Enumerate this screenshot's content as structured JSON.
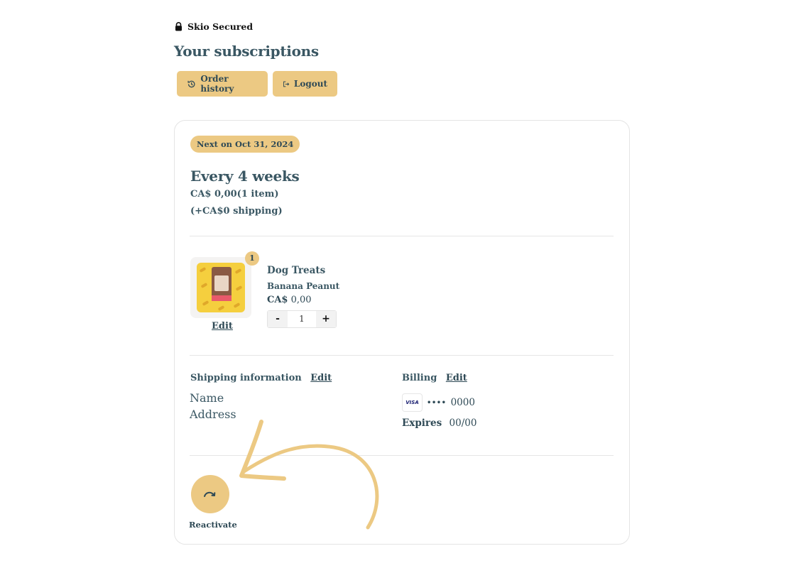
{
  "secured_label": "Skio Secured",
  "page_title": "Your subscriptions",
  "header_buttons": {
    "order_history": "Order history",
    "logout": "Logout"
  },
  "subscription": {
    "next_badge": "Next on Oct 31, 2024",
    "frequency": "Every 4 weeks",
    "price_summary": "CA$ 0,00(1 item)",
    "shipping_summary": "(+CA$0 shipping)",
    "item": {
      "quantity_badge": "1",
      "edit_label": "Edit",
      "name": "Dog Treats",
      "variant": "Banana Peanut",
      "currency": "CA$",
      "price": "0,00",
      "quantity": "1",
      "decrement": "-",
      "increment": "+"
    },
    "shipping": {
      "heading": "Shipping information",
      "edit_label": "Edit",
      "name": "Name",
      "address": "Address"
    },
    "billing": {
      "heading": "Billing",
      "edit_label": "Edit",
      "card_brand": "VISA",
      "card_dots": "••••",
      "card_last4": "0000",
      "expires_label": "Expires",
      "expires_value": "00/00"
    },
    "reactivate_label": "Reactivate"
  },
  "colors": {
    "accent": "#ecc983",
    "text": "#2f4a56",
    "border": "#e4e4e4"
  }
}
